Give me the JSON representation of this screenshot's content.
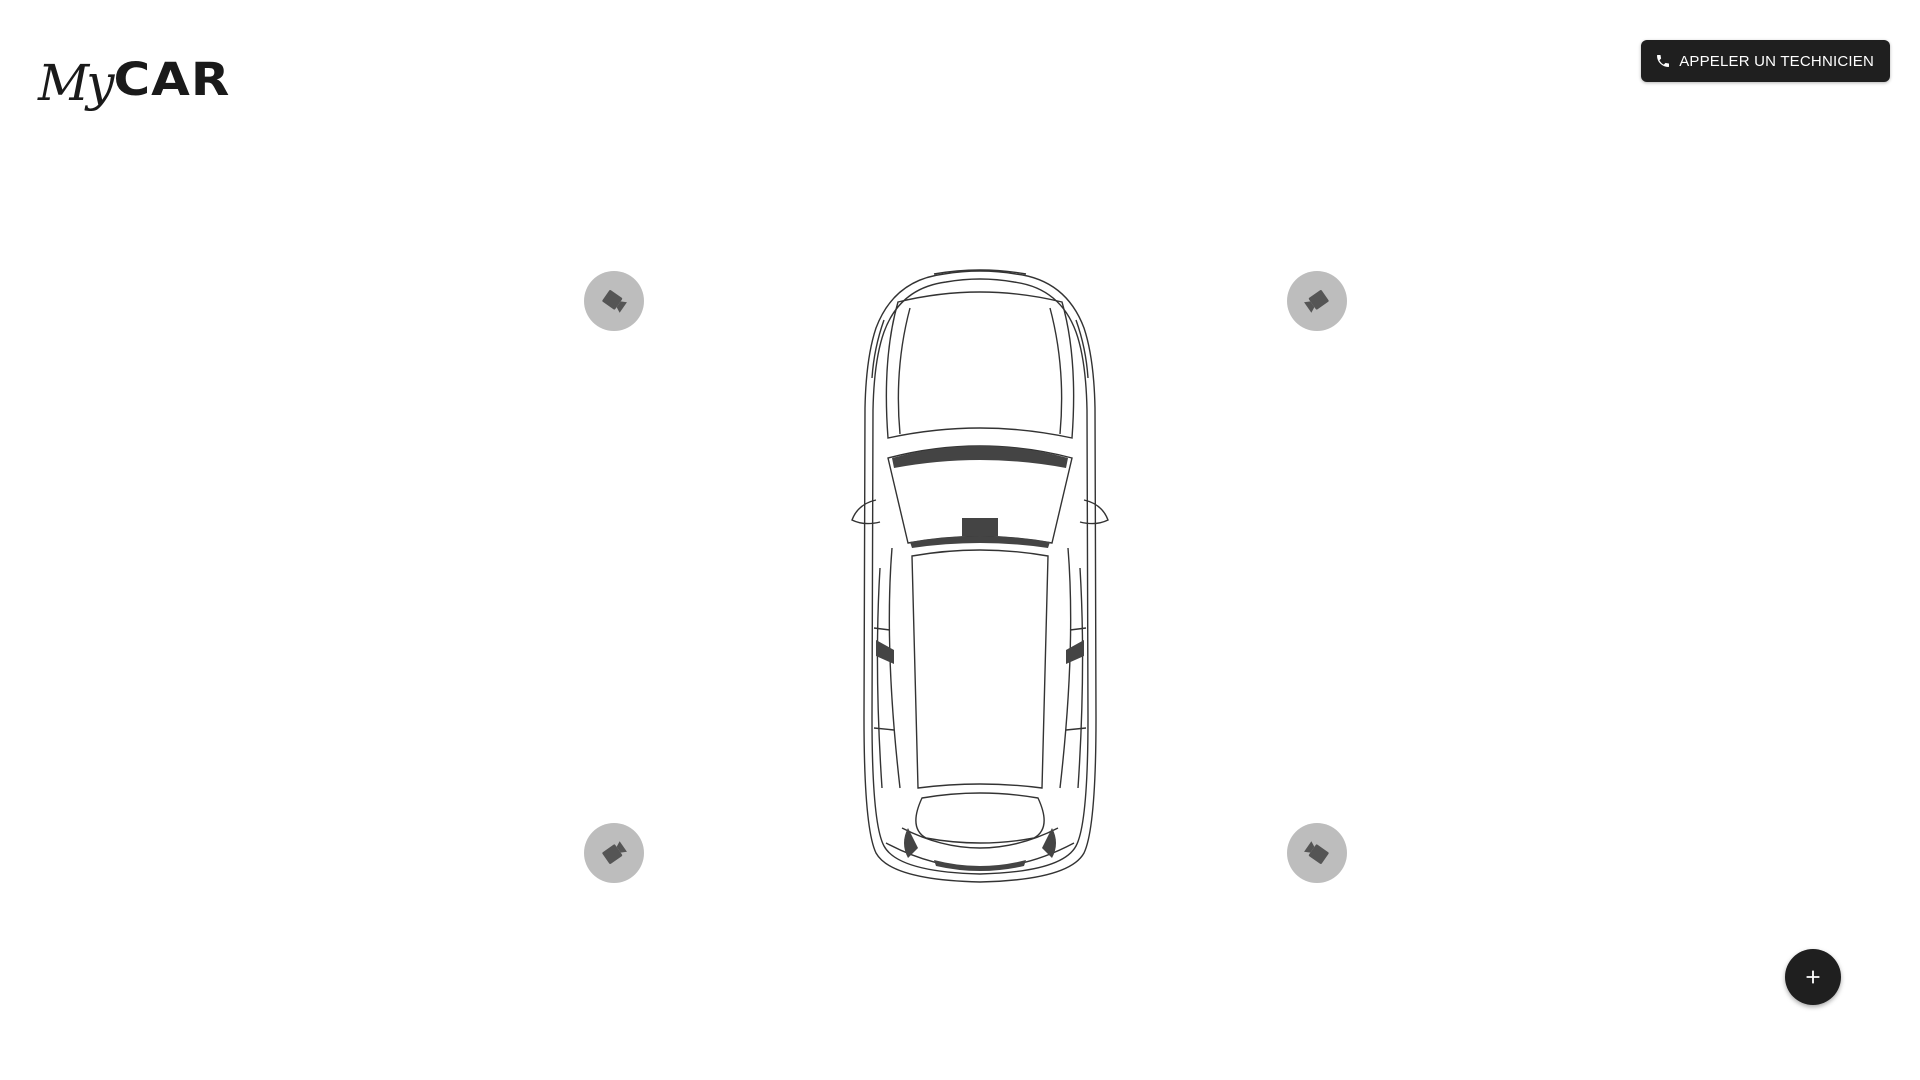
{
  "header": {
    "logo": {
      "my": "My",
      "car": "CAR"
    },
    "call_button": {
      "label": "APPELER UN TECHNICIEN",
      "icon": "phone-icon"
    }
  },
  "camera_buttons": [
    {
      "position": "front-left",
      "icon": "camera-tag-icon"
    },
    {
      "position": "front-right",
      "icon": "camera-tag-icon"
    },
    {
      "position": "rear-left",
      "icon": "camera-tag-icon"
    },
    {
      "position": "rear-right",
      "icon": "camera-tag-icon"
    }
  ],
  "car_diagram": {
    "view": "top",
    "icon": "car-top-view"
  },
  "fab": {
    "icon": "plus-icon"
  },
  "colors": {
    "dark": "#1f1f1f",
    "camera_bg": "#bdbdbd",
    "camera_icon": "#555555",
    "background": "#ffffff"
  }
}
